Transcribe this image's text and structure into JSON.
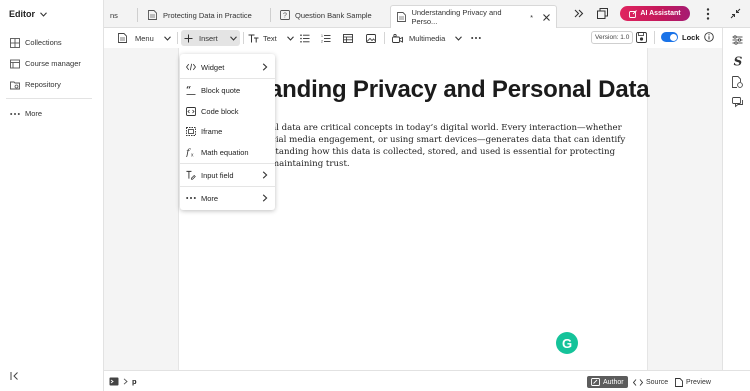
{
  "sidebar": {
    "title": "Editor",
    "items": [
      {
        "label": "Collections",
        "icon": "grid-icon"
      },
      {
        "label": "Course manager",
        "icon": "course-icon"
      },
      {
        "label": "Repository",
        "icon": "repository-icon"
      }
    ],
    "more_label": "More"
  },
  "tabs": [
    {
      "label": "ns",
      "active": false
    },
    {
      "label": "Protecting Data in Practice",
      "active": false
    },
    {
      "label": "Question Bank Sample",
      "active": false
    },
    {
      "label": "Understanding Privacy and Perso...",
      "active": true,
      "modified_marker": "*"
    }
  ],
  "header": {
    "ai_label": "AI Assistant"
  },
  "toolbar": {
    "menu_label": "Menu",
    "insert_label": "Insert",
    "text_label": "Text",
    "multimedia_label": "Multimedia",
    "version_label": "Version: 1.0",
    "lock_label": "Lock",
    "lock_on": true
  },
  "document": {
    "title": "anding Privacy and Personal Data",
    "lines": [
      "al data are critical concepts in today’s digital world. Every interaction—whether",
      "cial media engagement, or using smart devices—generates data that can identify",
      "standing how this data is collected, stored, and used is essential for protecting",
      "maintaining trust."
    ]
  },
  "insert_menu": {
    "items": [
      {
        "label": "Widget",
        "icon": "code-icon",
        "submenu": true
      },
      {
        "label": "Block quote",
        "icon": "quote-icon",
        "submenu": false
      },
      {
        "label": "Code block",
        "icon": "code-block-icon",
        "submenu": false
      },
      {
        "label": "Iframe",
        "icon": "iframe-icon",
        "submenu": false
      },
      {
        "label": "Math equation",
        "icon": "function-icon",
        "submenu": false
      },
      {
        "label": "Input field",
        "icon": "input-field-icon",
        "submenu": true
      },
      {
        "label": "More",
        "icon": "more-icon",
        "submenu": true
      }
    ]
  },
  "statusbar": {
    "breadcrumb_element": "p",
    "author_label": "Author",
    "source_label": "Source",
    "preview_label": "Preview"
  },
  "colors": {
    "accent": "#1a73e8",
    "ai_gradient_start": "#e0245e",
    "grammarly": "#15c39a"
  }
}
